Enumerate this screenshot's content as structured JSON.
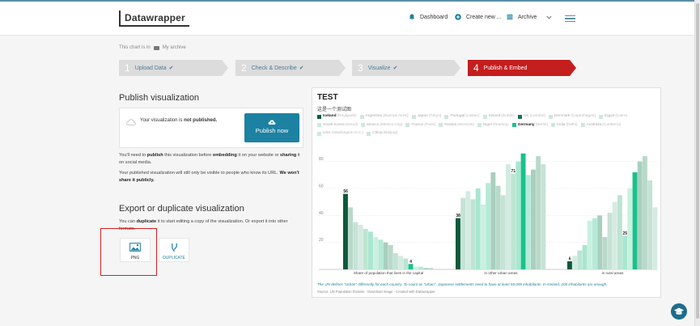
{
  "header": {
    "logo": "Datawrapper",
    "nav": [
      {
        "label": "Dashboard",
        "icon": "bell-icon"
      },
      {
        "label": "Create new ...",
        "icon": "plus-circle-icon"
      },
      {
        "label": "Archive",
        "icon": "list-icon"
      }
    ]
  },
  "breadcrumb": {
    "prefix": "This chart is in",
    "folder": "My archive"
  },
  "steps": [
    {
      "num": "1",
      "label": "Upload Data",
      "state": "done"
    },
    {
      "num": "2",
      "label": "Check & Describe",
      "state": "done"
    },
    {
      "num": "3",
      "label": "Visualize",
      "state": "done"
    },
    {
      "num": "4",
      "label": "Publish & Embed",
      "state": "active"
    }
  ],
  "publish": {
    "heading": "Publish visualization",
    "status_pre": "Your visualization is",
    "status_bold": "not published.",
    "button": "Publish now",
    "para1_a": "You'll need to",
    "para1_b": "publish",
    "para1_c": "this visualization before",
    "para1_d": "embedding",
    "para1_e": "it on your website or",
    "para1_f": "sharing",
    "para1_g": "it on social media.",
    "para2_a": "Your published visualization will still only be visible to people who know its URL.",
    "para2_b": "We won't share it publicly."
  },
  "export": {
    "heading": "Export or duplicate visualization",
    "text_a": "You can",
    "text_b": "duplicate",
    "text_c": "it to start editing a copy of the visualization. Or export it into other formats.",
    "tiles": [
      {
        "label": "PNG",
        "icon": "image-icon"
      },
      {
        "label": "DUPLICATE",
        "icon": "fork-icon"
      }
    ]
  },
  "chart_data": {
    "type": "bar",
    "title": "TEST",
    "subtitle": "这是一个测试图",
    "legend": [
      {
        "name": "Iceland",
        "city": "(Reykjavík)",
        "color": "#0b5a3c",
        "active": true
      },
      {
        "name": "Argentina",
        "city": "(Buenos Aires)",
        "color": "#cfe7dc",
        "active": false
      },
      {
        "name": "Japan",
        "city": "(Tokyo)",
        "color": "#cfe7dc",
        "active": false
      },
      {
        "name": "Portugal",
        "city": "(Lisbon)",
        "color": "#cfe7dc",
        "active": false
      },
      {
        "name": "Ireland",
        "city": "(Dublin)",
        "color": "#cfe7dc",
        "active": false
      },
      {
        "name": "UK",
        "city": "(London)",
        "color": "#1f6f4f",
        "active": false
      },
      {
        "name": "Denmark",
        "city": "(Copenhagen)",
        "color": "#cfe7dc",
        "active": false
      },
      {
        "name": "Egypt",
        "city": "(Cairo)",
        "color": "#cfe7dc",
        "active": false
      },
      {
        "name": "South Korea",
        "city": "(Seoul)",
        "color": "#cfe7dc",
        "active": false
      },
      {
        "name": "Mexico",
        "city": "(Mexico City)",
        "color": "#cfe7dc",
        "active": false
      },
      {
        "name": "France",
        "city": "(Paris)",
        "color": "#cfe7dc",
        "active": false
      },
      {
        "name": "Russia",
        "city": "(Moscow)",
        "color": "#cfe7dc",
        "active": false
      },
      {
        "name": "Niger",
        "city": "(Niamey)",
        "color": "#cfe7dc",
        "active": false
      },
      {
        "name": "Germany",
        "city": "(Berlin)",
        "color": "#18c28a",
        "active": true
      },
      {
        "name": "India",
        "city": "(Delhi)",
        "color": "#cfe7dc",
        "active": false
      },
      {
        "name": "Australia",
        "city": "(Canberra)",
        "color": "#cfe7dc",
        "active": false
      },
      {
        "name": "USA",
        "city": "(Washington D.C.)",
        "color": "#cfe7dc",
        "active": false
      },
      {
        "name": "China",
        "city": "(Beijing)",
        "color": "#cfe7dc",
        "active": false
      }
    ],
    "categories": [
      "Share of population that lives in the capital",
      "in other urban areas",
      "in rural areas"
    ],
    "yticks": [
      20,
      40,
      60,
      80
    ],
    "ylim": [
      0,
      90
    ],
    "grid": true,
    "groups": [
      [
        56,
        46,
        35,
        33,
        30,
        28,
        24,
        22,
        20,
        18,
        12,
        10,
        8,
        4,
        2,
        2,
        1,
        1
      ],
      [
        38,
        53,
        58,
        52,
        60,
        48,
        64,
        72,
        62,
        55,
        78,
        71,
        80,
        86,
        70,
        74,
        84,
        78
      ],
      [
        6,
        10,
        14,
        18,
        36,
        38,
        40,
        24,
        42,
        50,
        55,
        25,
        60,
        72,
        80,
        84,
        66,
        46
      ]
    ],
    "highlight": {
      "0": "#0b5a3c",
      "13": "#18c28a"
    },
    "labels": [
      {
        "group": 0,
        "bar": 0,
        "text": "56"
      },
      {
        "group": 0,
        "bar": 13,
        "text": "4"
      },
      {
        "group": 1,
        "bar": 0,
        "text": "38"
      },
      {
        "group": 1,
        "bar": 11,
        "text": "71"
      },
      {
        "group": 2,
        "bar": 0,
        "text": "6"
      },
      {
        "group": 2,
        "bar": 11,
        "text": "25"
      }
    ],
    "note": "The UN defines \"Urban\" differently for each country. To count as \"urban\", Japanese settlements need to have at least 50,000 inhabitants. In Iceland, 200 inhabitants are enough.",
    "source": "Source: UN Population Division · Download image · Created with Datawrapper"
  }
}
